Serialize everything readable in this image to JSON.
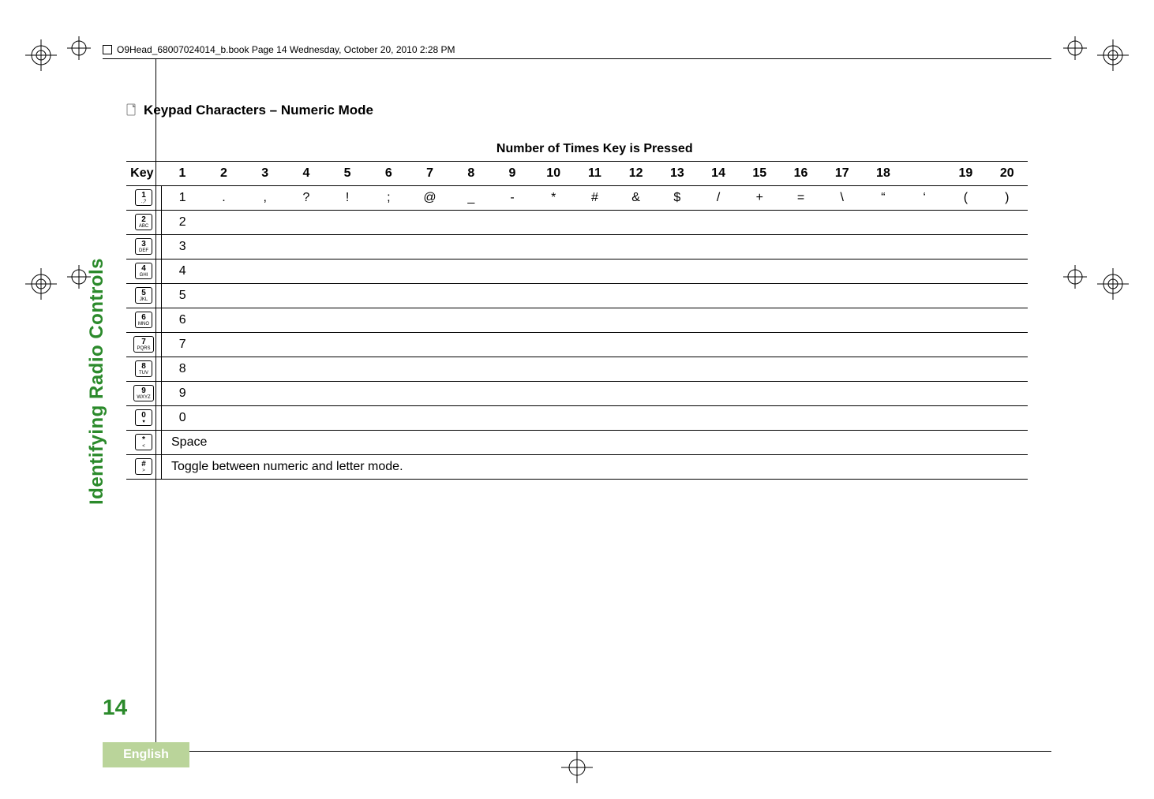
{
  "doc_header": "O9Head_68007024014_b.book  Page 14  Wednesday, October 20, 2010  2:28 PM",
  "side_label": "Identifying Radio Controls",
  "page_number": "14",
  "language_tab": "English",
  "section_title": "Keypad Characters – Numeric Mode",
  "table": {
    "super_header": "Number of Times Key is Pressed",
    "key_label": "Key",
    "columns": [
      "1",
      "2",
      "3",
      "4",
      "5",
      "6",
      "7",
      "8",
      "9",
      "10",
      "11",
      "12",
      "13",
      "14",
      "15",
      "16",
      "17",
      "18",
      "",
      "19",
      "20"
    ],
    "rows": [
      {
        "key_num": "1",
        "key_sub": ".,?",
        "values": [
          "1",
          ".",
          ",",
          "?",
          "!",
          ";",
          "@",
          "_",
          "-",
          "*",
          "#",
          "&",
          "$",
          "/",
          "+",
          "=",
          "\\",
          "“",
          "‘",
          "(",
          ")"
        ]
      },
      {
        "key_num": "2",
        "key_sub": "ABC",
        "values": [
          "2"
        ]
      },
      {
        "key_num": "3",
        "key_sub": "DEF",
        "values": [
          "3"
        ]
      },
      {
        "key_num": "4",
        "key_sub": "GHI",
        "values": [
          "4"
        ]
      },
      {
        "key_num": "5",
        "key_sub": "JKL",
        "values": [
          "5"
        ]
      },
      {
        "key_num": "6",
        "key_sub": "MNO",
        "values": [
          "6"
        ]
      },
      {
        "key_num": "7",
        "key_sub": "PQRS",
        "values": [
          "7"
        ]
      },
      {
        "key_num": "8",
        "key_sub": "TUV",
        "values": [
          "8"
        ]
      },
      {
        "key_num": "9",
        "key_sub": "WXYZ",
        "values": [
          "9"
        ]
      },
      {
        "key_num": "0",
        "key_sub": "♥",
        "values": [
          "0"
        ]
      },
      {
        "key_num": "*",
        "key_sub": "<",
        "span_text": "Space"
      },
      {
        "key_num": "#",
        "key_sub": ">",
        "span_text": "Toggle between numeric and letter mode."
      }
    ]
  }
}
